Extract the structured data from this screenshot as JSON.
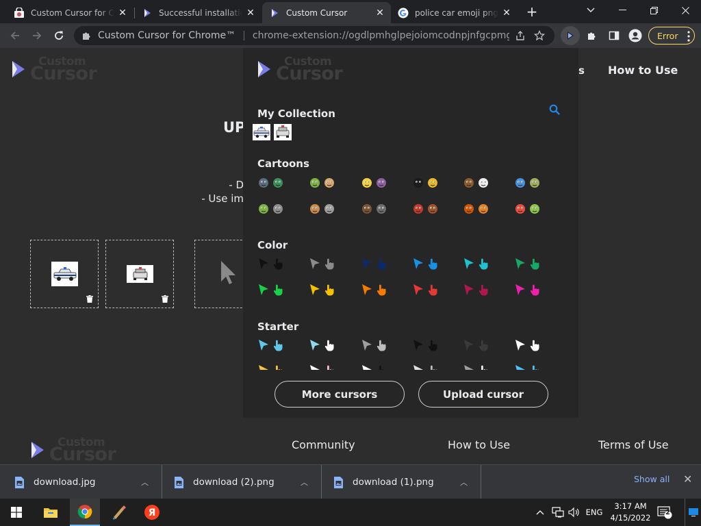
{
  "tabs": [
    {
      "title": "Custom Cursor for Chrome™",
      "favicon": "chrome-web-store-icon"
    },
    {
      "title": "Successful installation - Custom Cursor",
      "favicon": "custom-cursor-icon"
    },
    {
      "title": "Custom Cursor",
      "favicon": "custom-cursor-icon"
    },
    {
      "title": "police car emoji png - Google Search",
      "favicon": "google-icon"
    }
  ],
  "omnibox": {
    "site_name": "Custom Cursor for Chrome™",
    "url": "chrome-extension://ogdlpmhglpejoiomcodnpjnfgcpmgale/options.html"
  },
  "error_button": {
    "label": "Error"
  },
  "page": {
    "logo_top": "Custom",
    "logo_bottom": "Cursor",
    "title_fragment": "UP",
    "instruction_1": "- D",
    "instruction_2": "- Use im",
    "nav_partial": "s",
    "nav_how_to_use": "How to Use",
    "footer": {
      "community": "Community",
      "how_to_use": "How to Use",
      "terms": "Terms of Use"
    }
  },
  "popup": {
    "my_collection": "My Collection",
    "cartoons": "Cartoons",
    "color": "Color",
    "starter": "Starter",
    "more_cursors": "More cursors",
    "upload_cursor": "Upload cursor",
    "color_pairs": [
      "#111111",
      "#8a8a8a",
      "#0b2a6b",
      "#1592e6",
      "#1ec3cf",
      "#17a866",
      "#16d24a",
      "#f2c200",
      "#f57c00",
      "#e53935",
      "#b0174f",
      "#f01fae"
    ]
  },
  "downloads": [
    {
      "name": "download.jpg"
    },
    {
      "name": "download (2).png"
    },
    {
      "name": "download (1).png"
    }
  ],
  "show_all": "Show all",
  "taskbar": {
    "lang": "ENG",
    "time": "3:17 AM",
    "date": "4/15/2022",
    "notifications": "2"
  }
}
